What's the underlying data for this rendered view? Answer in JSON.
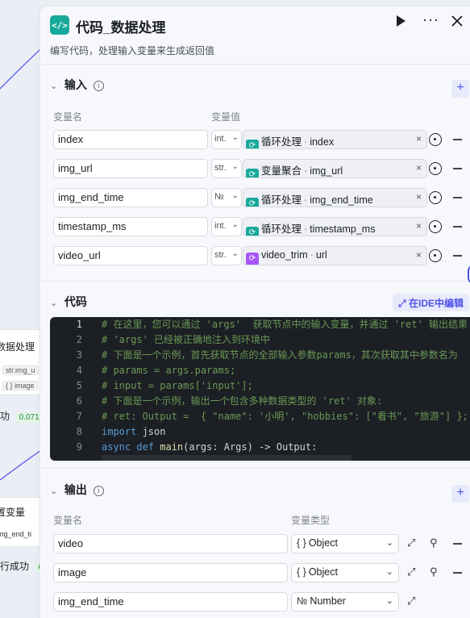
{
  "canvas": {
    "node_loop": {
      "title": "数据处理",
      "tags": [
        "str.img_u",
        "{ } image"
      ]
    },
    "success_a": {
      "label": "功",
      "badge": "0.071s"
    },
    "node_set": {
      "title": "置变量",
      "field": "img_end_ti"
    },
    "success_b": {
      "label": "行成功",
      "badge": "0."
    }
  },
  "header": {
    "icon": "</>",
    "title": "代码_数据处理",
    "description": "编写代码，处理输入变量来生成返回值",
    "run_icon": "play-icon",
    "more_icon": "more-icon",
    "close_icon": "close-icon"
  },
  "inputs": {
    "title": "输入",
    "col_name": "变量名",
    "col_value": "变量值",
    "rows": [
      {
        "name": "index",
        "type": "int.",
        "source_color": "#17a99a",
        "source_node": "循环处理",
        "sep": "·",
        "source_var": "index"
      },
      {
        "name": "img_url",
        "type": "str.",
        "source_color": "#17a99a",
        "source_node": "变量聚合",
        "sep": "·",
        "source_var": "img_url"
      },
      {
        "name": "img_end_time",
        "type": "№",
        "source_color": "#17a99a",
        "source_node": "循环处理",
        "sep": "·",
        "source_var": "img_end_time"
      },
      {
        "name": "timestamp_ms",
        "type": "int.",
        "source_color": "#17a99a",
        "source_node": "循环处理",
        "sep": "·",
        "source_var": "timestamp_ms"
      },
      {
        "name": "video_url",
        "type": "str.",
        "source_color": "#a855f7",
        "source_node": "video_trim",
        "sep": "·",
        "source_var": "url"
      }
    ]
  },
  "code": {
    "title": "代码",
    "ide_label": "在IDE中编辑",
    "lines": [
      {
        "n": "1",
        "parts": [
          {
            "c": "cm",
            "t": "# 在这里，您可以通过 'args'  获取节点中的输入变量，并通过 'ret' 输出结果"
          }
        ]
      },
      {
        "n": "2",
        "parts": [
          {
            "c": "cm",
            "t": "# 'args' 已经被正确地注入到环境中"
          }
        ]
      },
      {
        "n": "3",
        "parts": [
          {
            "c": "cm",
            "t": "# 下面是一个示例，首先获取节点的全部输入参数params，其次获取其中参数名为"
          }
        ]
      },
      {
        "n": "4",
        "parts": [
          {
            "c": "cm",
            "t": "# params = args.params;"
          }
        ]
      },
      {
        "n": "5",
        "parts": [
          {
            "c": "cm",
            "t": "# input = params['input'];"
          }
        ]
      },
      {
        "n": "6",
        "parts": [
          {
            "c": "cm",
            "t": "# 下面是一个示例，输出一个包含多种数据类型的 'ret' 对象:"
          }
        ]
      },
      {
        "n": "7",
        "parts": [
          {
            "c": "cm",
            "t": "# ret: Output =  { \"name\": '小明', \"hobbies\": [\"看书\", \"旅游\"] };"
          }
        ]
      },
      {
        "n": "8",
        "parts": [
          {
            "c": "kw",
            "t": "import"
          },
          {
            "c": "pl",
            "t": " json"
          }
        ]
      },
      {
        "n": "9",
        "parts": [
          {
            "c": "kw",
            "t": "async def"
          },
          {
            "c": "fn",
            "t": " main"
          },
          {
            "c": "pl",
            "t": "(args: Args) -> Output:"
          }
        ]
      }
    ]
  },
  "outputs": {
    "title": "输出",
    "col_name": "变量名",
    "col_type": "变量类型",
    "rows": [
      {
        "name": "video",
        "type_icon": "{ }",
        "type": "Object"
      },
      {
        "name": "image",
        "type_icon": "{ }",
        "type": "Object"
      },
      {
        "name": "img_end_time",
        "type_icon": "№",
        "type": "Number"
      }
    ]
  }
}
